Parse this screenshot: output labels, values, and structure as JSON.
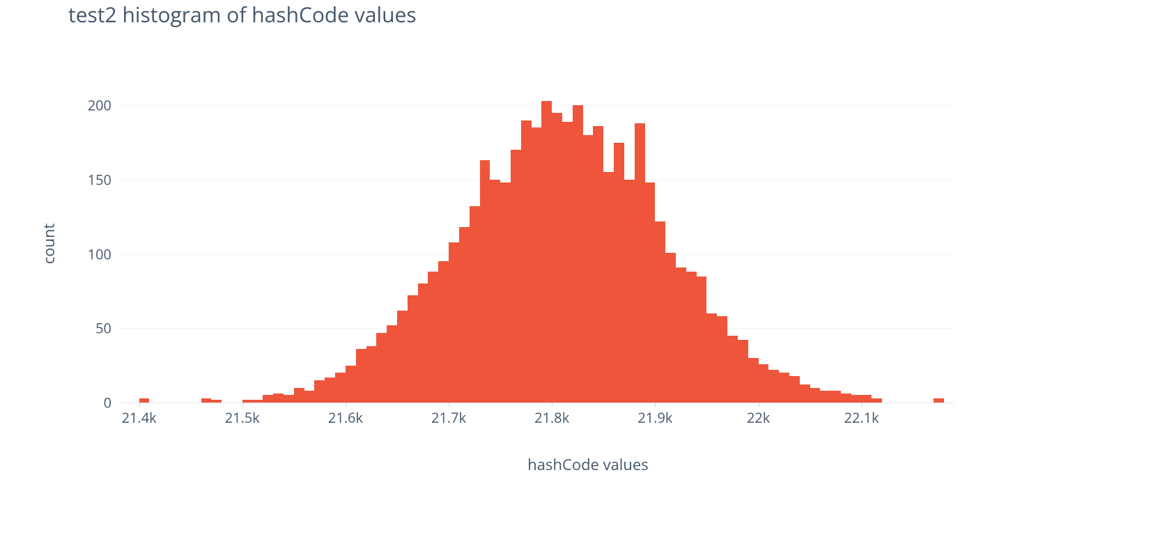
{
  "chart_data": {
    "type": "bar",
    "title": "test2 histogram of hashCode values",
    "xlabel": "hashCode values",
    "ylabel": "count",
    "bar_color": "#ee553b",
    "xlim": [
      21380,
      22190
    ],
    "ylim": [
      0,
      210
    ],
    "x_ticks": [
      21400,
      21500,
      21600,
      21700,
      21800,
      21900,
      22000,
      22100
    ],
    "x_tick_labels": [
      "21.4k",
      "21.5k",
      "21.6k",
      "21.7k",
      "21.8k",
      "21.9k",
      "22k",
      "22.1k"
    ],
    "y_ticks": [
      0,
      50,
      100,
      150,
      200
    ],
    "y_tick_labels": [
      "0",
      "50",
      "100",
      "150",
      "200"
    ],
    "bin_width": 10,
    "bins_start_x": [
      21400,
      21460,
      21470,
      21500,
      21510,
      21520,
      21530,
      21540,
      21550,
      21560,
      21570,
      21580,
      21590,
      21600,
      21610,
      21620,
      21630,
      21640,
      21650,
      21660,
      21670,
      21680,
      21690,
      21700,
      21710,
      21720,
      21730,
      21740,
      21750,
      21760,
      21770,
      21780,
      21790,
      21800,
      21810,
      21820,
      21830,
      21840,
      21850,
      21860,
      21870,
      21880,
      21890,
      21900,
      21910,
      21920,
      21930,
      21940,
      21950,
      21960,
      21970,
      21980,
      21990,
      22000,
      22010,
      22020,
      22030,
      22040,
      22050,
      22060,
      22070,
      22080,
      22090,
      22100,
      22110,
      22170
    ],
    "values": [
      3,
      3,
      2,
      2,
      2,
      5,
      6,
      5,
      10,
      8,
      15,
      17,
      20,
      25,
      36,
      38,
      47,
      52,
      62,
      72,
      80,
      88,
      95,
      108,
      118,
      132,
      163,
      150,
      148,
      170,
      190,
      185,
      203,
      195,
      189,
      200,
      180,
      186,
      155,
      175,
      150,
      188,
      148,
      122,
      101,
      91,
      88,
      85,
      60,
      58,
      45,
      42,
      30,
      26,
      22,
      20,
      18,
      12,
      10,
      8,
      8,
      6,
      5,
      5,
      3,
      3
    ]
  }
}
